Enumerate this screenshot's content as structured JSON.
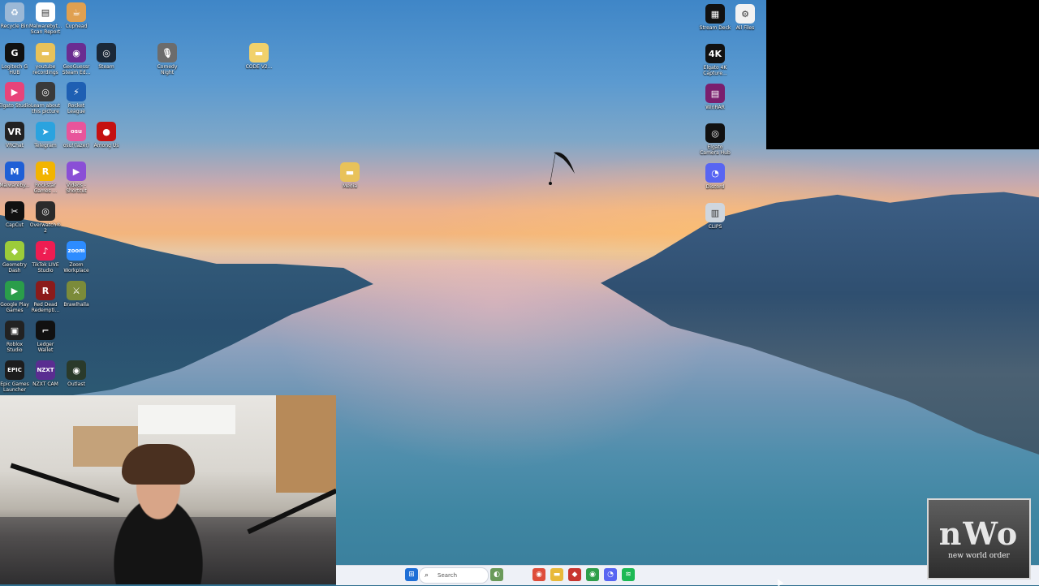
{
  "desktop": {
    "icons": [
      {
        "label": "Recycle Bin",
        "icon": "recycle-bin-icon",
        "color": "#9bb8d6",
        "glyph": "♻"
      },
      {
        "label": "Malwarebyt... Scan Report",
        "icon": "document-icon",
        "color": "#ffffff",
        "glyph": "▤"
      },
      {
        "label": "Cuphead",
        "icon": "cuphead-icon",
        "color": "#e0a050",
        "glyph": "☕"
      },
      {
        "label": "Logitech G HUB",
        "icon": "logitech-icon",
        "color": "#111111",
        "glyph": "G"
      },
      {
        "label": "youtube recordings",
        "icon": "folder-icon",
        "color": "#e8c25a",
        "glyph": "▬"
      },
      {
        "label": "GeoGuessr Steam Ed...",
        "icon": "geoguessr-icon",
        "color": "#6a2c91",
        "glyph": "◉"
      },
      {
        "label": "Steam",
        "icon": "steam-icon",
        "color": "#1b2838",
        "glyph": "◎"
      },
      {
        "label": "Comedy Night",
        "icon": "microphone-icon",
        "color": "#6c6c6c",
        "glyph": "🎙"
      },
      {
        "label": "CODE V2...",
        "icon": "folder-icon",
        "color": "#f1d16b",
        "glyph": "▬"
      },
      {
        "label": "Elgato Studio",
        "icon": "elgato-studio-icon",
        "color": "#e8447a",
        "glyph": "▶"
      },
      {
        "label": "Learn about this picture",
        "icon": "camera-icon",
        "color": "#3a3a3a",
        "glyph": "◎"
      },
      {
        "label": "Rocket League",
        "icon": "rocket-league-icon",
        "color": "#1e5fb3",
        "glyph": "⚡"
      },
      {
        "label": "VRChat",
        "icon": "vrchat-icon",
        "color": "#222222",
        "glyph": "VR"
      },
      {
        "label": "Telegram",
        "icon": "telegram-icon",
        "color": "#2aa3df",
        "glyph": "➤"
      },
      {
        "label": "osu!(lazer)",
        "icon": "osu-icon",
        "color": "#e8559b",
        "glyph": "osu"
      },
      {
        "label": "Among Us",
        "icon": "among-us-icon",
        "color": "#c51111",
        "glyph": "●"
      },
      {
        "label": "Malwareby...",
        "icon": "malwarebytes-icon",
        "color": "#1f5fd6",
        "glyph": "M"
      },
      {
        "label": "Rockstar Games ...",
        "icon": "rockstar-icon",
        "color": "#f2b400",
        "glyph": "R"
      },
      {
        "label": "Videos - Shortcut",
        "icon": "videos-icon",
        "color": "#8a4fd6",
        "glyph": "▶"
      },
      {
        "label": "CapCut",
        "icon": "capcut-icon",
        "color": "#111111",
        "glyph": "✂"
      },
      {
        "label": "Overwatch® 2",
        "icon": "overwatch-icon",
        "color": "#2b2b2b",
        "glyph": "◎"
      },
      {
        "label": "Geometry Dash",
        "icon": "geometry-dash-icon",
        "color": "#9ccc3a",
        "glyph": "◆"
      },
      {
        "label": "TikTok LIVE Studio",
        "icon": "tiktok-icon",
        "color": "#ee1d52",
        "glyph": "♪"
      },
      {
        "label": "Zoom Workplace",
        "icon": "zoom-icon",
        "color": "#2d8cff",
        "glyph": "zoom"
      },
      {
        "label": "Google Play Games",
        "icon": "google-play-icon",
        "color": "#2a9d4a",
        "glyph": "▶"
      },
      {
        "label": "Red Dead Redempti...",
        "icon": "red-dead-icon",
        "color": "#8b1b1b",
        "glyph": "R"
      },
      {
        "label": "Brawlhalla",
        "icon": "brawlhalla-icon",
        "color": "#7b8b3a",
        "glyph": "⚔"
      },
      {
        "label": "Roblox Studio",
        "icon": "roblox-icon",
        "color": "#222222",
        "glyph": "▣"
      },
      {
        "label": "Ledger Wallet",
        "icon": "ledger-icon",
        "color": "#111111",
        "glyph": "⌐"
      },
      {
        "label": "Epic Games Launcher",
        "icon": "epic-games-icon",
        "color": "#1d1d1d",
        "glyph": "EPIC"
      },
      {
        "label": "NZXT CAM",
        "icon": "nzxt-icon",
        "color": "#5a2d91",
        "glyph": "NZXT"
      },
      {
        "label": "Outlast",
        "icon": "outlast-icon",
        "color": "#2a3a2a",
        "glyph": "◉"
      },
      {
        "label": "Media",
        "icon": "folder-icon",
        "color": "#e8c25a",
        "glyph": "▬"
      },
      {
        "label": "Stream Deck",
        "icon": "stream-deck-icon",
        "color": "#111111",
        "glyph": "▦"
      },
      {
        "label": "All Files",
        "icon": "settings-window-icon",
        "color": "#f2f2f2",
        "glyph": "⚙"
      },
      {
        "label": "Elgato 4K Capture...",
        "icon": "elgato-4k-icon",
        "color": "#111111",
        "glyph": "4K"
      },
      {
        "label": "WinRAR",
        "icon": "winrar-icon",
        "color": "#7a1f6e",
        "glyph": "▤"
      },
      {
        "label": "Elgato Camera Hub",
        "icon": "elgato-camera-icon",
        "color": "#111111",
        "glyph": "◎"
      },
      {
        "label": "Discord",
        "icon": "discord-icon",
        "color": "#5865f2",
        "glyph": "◔"
      },
      {
        "label": "CLIPS",
        "icon": "film-icon",
        "color": "#cfd6de",
        "glyph": "▥"
      }
    ]
  },
  "taskbar": {
    "search_placeholder": "Search",
    "items": [
      {
        "icon": "windows-start-icon",
        "color": "#1f6fd6",
        "glyph": "⊞"
      },
      {
        "icon": "widgets-icon",
        "color": "#6a9a5a",
        "glyph": "◐"
      },
      {
        "icon": "chrome-icon",
        "color": "#de4d3a",
        "glyph": "◉"
      },
      {
        "icon": "file-explorer-icon",
        "color": "#e8b93a",
        "glyph": "▬"
      },
      {
        "icon": "red-app-icon",
        "color": "#c8352f",
        "glyph": "◆"
      },
      {
        "icon": "chrome-icon",
        "color": "#2f9e4a",
        "glyph": "◉"
      },
      {
        "icon": "discord-icon",
        "color": "#5865f2",
        "glyph": "◔"
      },
      {
        "icon": "spotify-icon",
        "color": "#1db954",
        "glyph": "≋"
      }
    ]
  },
  "overlay_logo": {
    "big_text": "nWo",
    "small_text": "new world order"
  }
}
